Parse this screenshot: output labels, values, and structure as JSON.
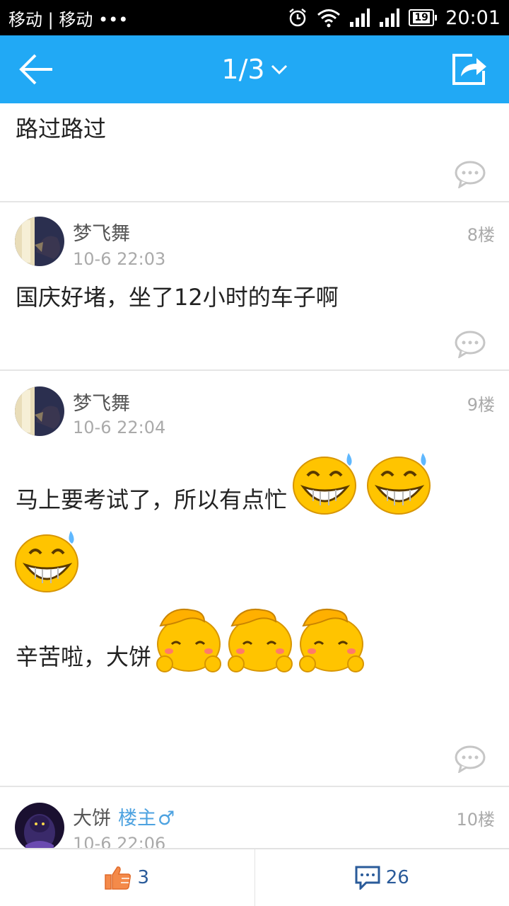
{
  "status_bar": {
    "carrier": "移动 | 移动 •••",
    "battery": "19",
    "time": "20:01"
  },
  "header": {
    "page_indicator": "1/3"
  },
  "posts": [
    {
      "body": "路过路过"
    },
    {
      "author": "梦飞舞",
      "time": "10-6 22:03",
      "floor": "8楼",
      "body": "国庆好堵，坐了12小时的车子啊"
    },
    {
      "author": "梦飞舞",
      "time": "10-6 22:04",
      "floor": "9楼",
      "body_line1": "马上要考试了，所以有点忙",
      "body_line2": "辛苦啦，大饼"
    },
    {
      "author": "大饼",
      "op_tag": "楼主",
      "gender": "♂",
      "time": "10-6 22:06",
      "floor": "10楼"
    }
  ],
  "bottom_bar": {
    "like_count": "3",
    "comment_count": "26"
  },
  "colors": {
    "accent": "#21a9f5",
    "op_tag": "#4da2e0"
  }
}
